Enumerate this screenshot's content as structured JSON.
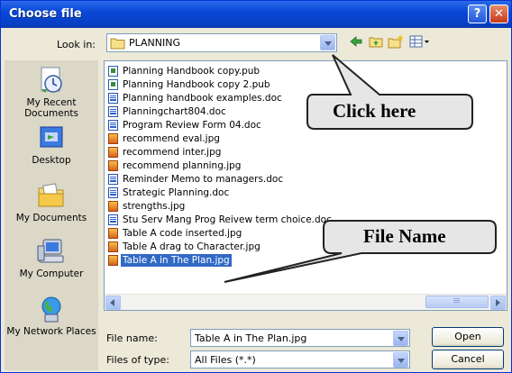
{
  "window": {
    "title": "Choose file"
  },
  "titlebar_buttons": {
    "help": "?",
    "close": "✕"
  },
  "lookin": {
    "label": "Look in:",
    "value": "PLANNING"
  },
  "toolbar": {
    "back_icon": "back-arrow-icon",
    "up_icon": "up-folder-icon",
    "new_folder_icon": "new-folder-icon",
    "views_icon": "views-menu-icon"
  },
  "places": [
    {
      "label": "My Recent Documents",
      "icon": "recent-documents-icon"
    },
    {
      "label": "Desktop",
      "icon": "desktop-icon"
    },
    {
      "label": "My Documents",
      "icon": "my-documents-icon"
    },
    {
      "label": "My Computer",
      "icon": "my-computer-icon"
    },
    {
      "label": "My Network Places",
      "icon": "network-places-icon"
    }
  ],
  "files": [
    {
      "name": "Planning Handbook  copy.pub",
      "type": "pub"
    },
    {
      "name": "Planning Handbook copy 2.pub",
      "type": "pub"
    },
    {
      "name": "Planning handbook examples.doc",
      "type": "doc"
    },
    {
      "name": "Planningchart804.doc",
      "type": "doc"
    },
    {
      "name": "Program Review Form 04.doc",
      "type": "doc"
    },
    {
      "name": "recommend eval.jpg",
      "type": "jpg"
    },
    {
      "name": "recommend inter.jpg",
      "type": "jpg"
    },
    {
      "name": "recommend planning.jpg",
      "type": "jpg"
    },
    {
      "name": "Reminder Memo to managers.doc",
      "type": "doc"
    },
    {
      "name": "Strategic Planning.doc",
      "type": "doc"
    },
    {
      "name": "strengths.jpg",
      "type": "jpg"
    },
    {
      "name": "Stu Serv Mang Prog Reivew term choice.doc",
      "type": "doc"
    },
    {
      "name": "Table A code inserted.jpg",
      "type": "jpg"
    },
    {
      "name": "Table A drag to Character.jpg",
      "type": "jpg"
    },
    {
      "name": "Table A in The Plan.jpg",
      "type": "jpg",
      "selected": true
    }
  ],
  "filename": {
    "label": "File name:",
    "value": "Table A in The Plan.jpg"
  },
  "filetype": {
    "label": "Files of type:",
    "value": "All Files (*.*)"
  },
  "buttons": {
    "open": "Open",
    "cancel": "Cancel"
  },
  "callouts": {
    "click_here": "Click here",
    "file_name": "File Name"
  },
  "colors": {
    "titlebar": "#0a48d6",
    "selection": "#316ac5",
    "dialog_bg": "#ece9d8",
    "callout_fill": "#e6e6e6"
  }
}
